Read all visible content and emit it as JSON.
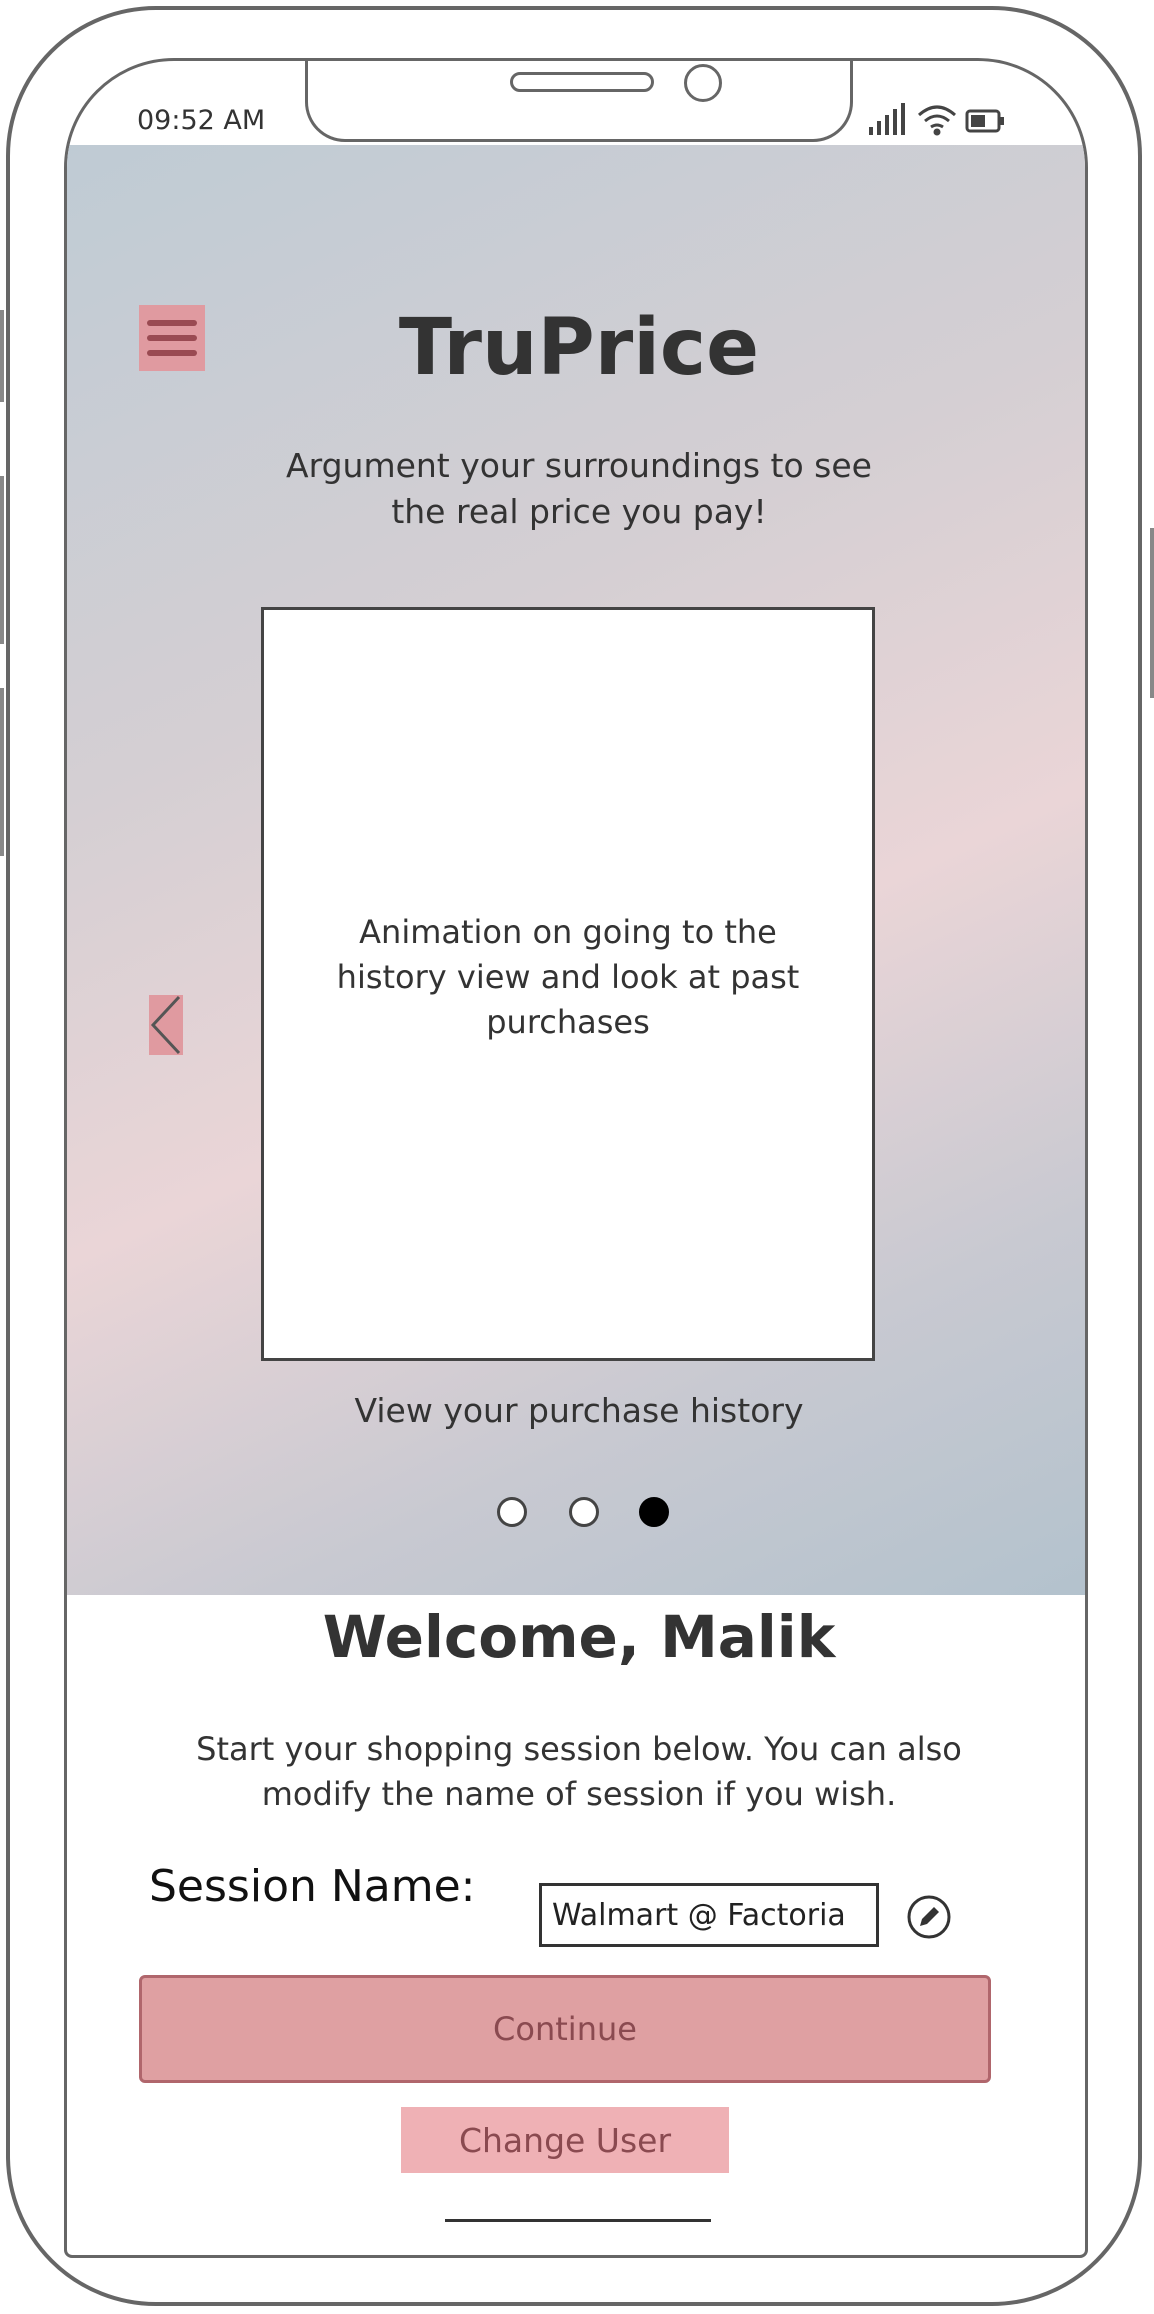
{
  "status_bar": {
    "time": "09:52 AM",
    "icons": [
      "signal-icon",
      "wifi-icon",
      "battery-icon"
    ]
  },
  "header": {
    "app_title": "TruPrice",
    "tagline": "Argument your surroundings to see the real price you pay!",
    "menu_icon": "hamburger-menu-icon"
  },
  "carousel": {
    "slide_text": "Animation on going to the history view and look at past purchases",
    "caption": "View your purchase history",
    "prev_icon": "chevron-left-icon",
    "slide_count": 3,
    "active_index": 2
  },
  "welcome": {
    "title": "Welcome, Malik",
    "description": "Start your shopping session below. You can also modify the name of session if you wish."
  },
  "session": {
    "label": "Session Name:",
    "value": "Walmart @ Factoria",
    "edit_icon": "pencil-icon"
  },
  "actions": {
    "continue_label": "Continue",
    "change_user_label": "Change User"
  },
  "colors": {
    "accent": "#dfa0a2",
    "accent_dark": "#9a4a52",
    "secondary_button": "#efb1b5",
    "text": "#333333"
  }
}
